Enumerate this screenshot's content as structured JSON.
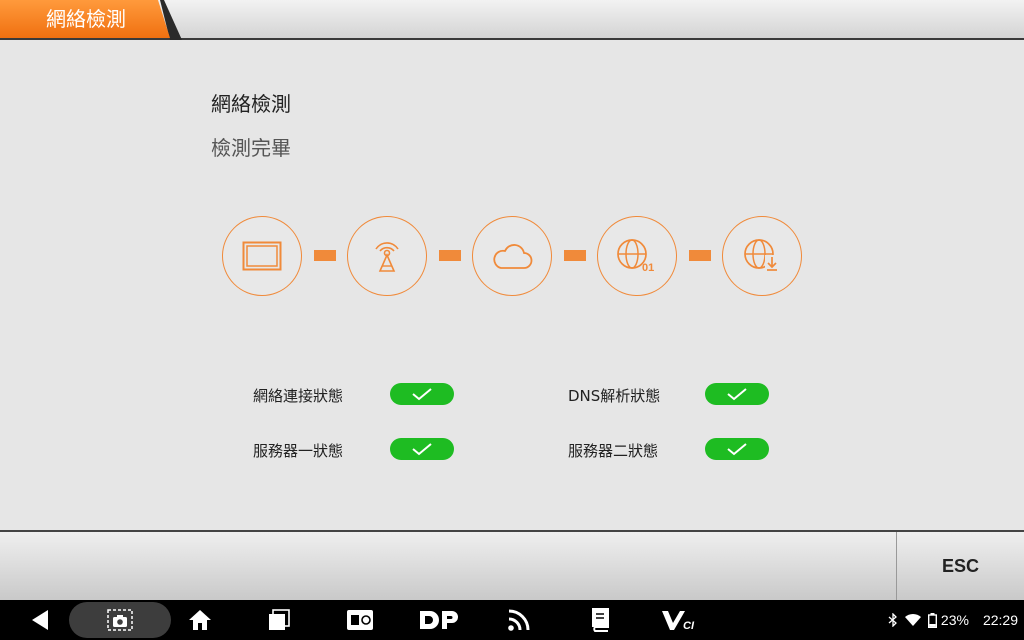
{
  "header": {
    "title": "網絡檢測"
  },
  "main": {
    "heading": "網絡檢測",
    "status": "檢測完畢",
    "steps": [
      {
        "icon": "tablet-icon"
      },
      {
        "icon": "antenna-icon"
      },
      {
        "icon": "cloud-icon"
      },
      {
        "icon": "globe-binary-icon",
        "badge": "01"
      },
      {
        "icon": "globe-download-icon"
      }
    ],
    "checks": [
      {
        "label": "網絡連接狀態",
        "state": "ok"
      },
      {
        "label": "DNS解析狀態",
        "state": "ok"
      },
      {
        "label": "服務器一狀態",
        "state": "ok"
      },
      {
        "label": "服務器二狀態",
        "state": "ok"
      }
    ]
  },
  "footer": {
    "esc_label": "ESC"
  },
  "system": {
    "battery": "23%",
    "time": "22:29",
    "colors": {
      "accent": "#f08a3a",
      "ok": "#1ebc22"
    }
  }
}
